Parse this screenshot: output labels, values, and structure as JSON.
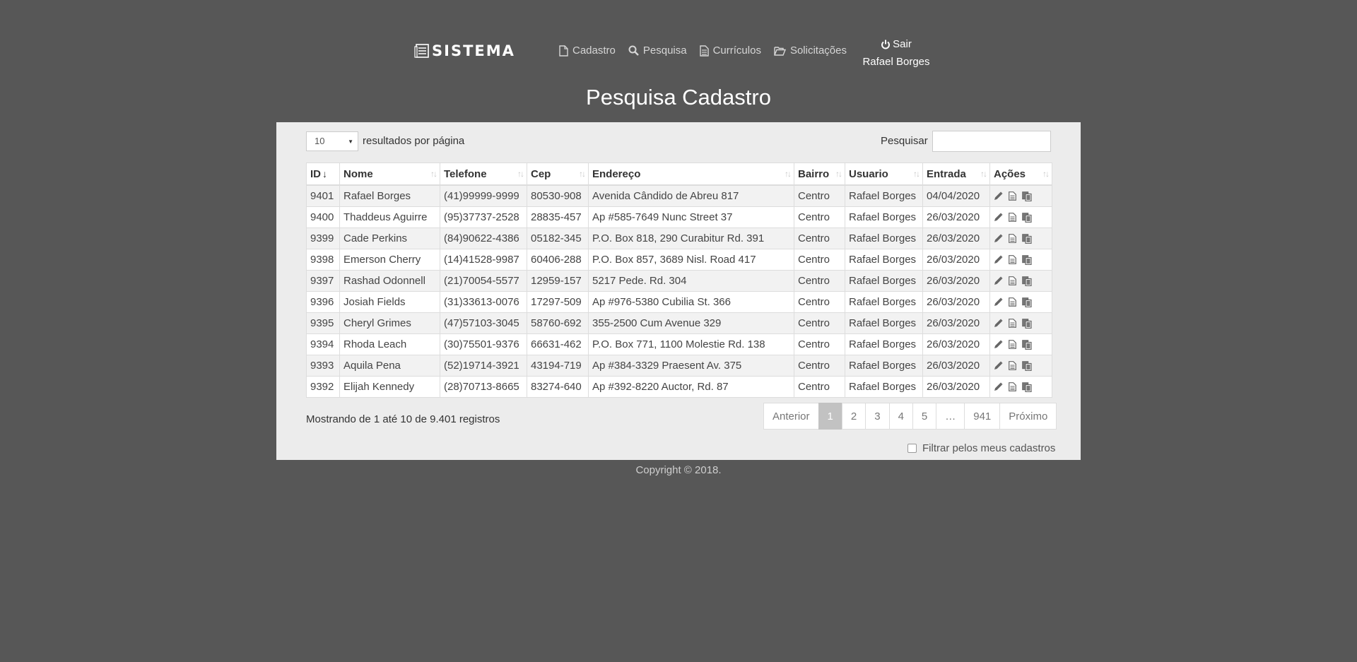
{
  "brand": {
    "name": "SISTEMA",
    "logo_icon": "list-icon"
  },
  "nav": [
    {
      "label": "Cadastro",
      "icon": "file-icon"
    },
    {
      "label": "Pesquisa",
      "icon": "search-icon"
    },
    {
      "label": "Currículos",
      "icon": "document-icon"
    },
    {
      "label": "Solicitações",
      "icon": "folder-open-icon"
    }
  ],
  "user": {
    "logout_label": "Sair",
    "logout_icon": "power-icon",
    "name": "Rafael Borges"
  },
  "page_title": "Pesquisa Cadastro",
  "controls": {
    "page_length": "10",
    "page_length_label": "resultados por página",
    "search_label": "Pesquisar",
    "search_value": ""
  },
  "table": {
    "columns": [
      "ID",
      "Nome",
      "Telefone",
      "Cep",
      "Endereço",
      "Bairro",
      "Usuario",
      "Entrada",
      "Ações"
    ],
    "sorted_column": "ID",
    "sort_direction": "descending",
    "action_icons": [
      "pencil-icon",
      "document-icon",
      "copy-icon"
    ],
    "rows": [
      [
        "9401",
        "Rafael Borges",
        "(41)99999-9999",
        "80530-908",
        "Avenida Cândido de Abreu 817",
        "Centro",
        "Rafael Borges",
        "04/04/2020"
      ],
      [
        "9400",
        "Thaddeus Aguirre",
        "(95)37737-2528",
        "28835-457",
        "Ap #585-7649 Nunc Street 37",
        "Centro",
        "Rafael Borges",
        "26/03/2020"
      ],
      [
        "9399",
        "Cade Perkins",
        "(84)90622-4386",
        "05182-345",
        "P.O. Box 818, 290 Curabitur Rd. 391",
        "Centro",
        "Rafael Borges",
        "26/03/2020"
      ],
      [
        "9398",
        "Emerson Cherry",
        "(14)41528-9987",
        "60406-288",
        "P.O. Box 857, 3689 Nisl. Road 417",
        "Centro",
        "Rafael Borges",
        "26/03/2020"
      ],
      [
        "9397",
        "Rashad Odonnell",
        "(21)70054-5577",
        "12959-157",
        "5217 Pede. Rd. 304",
        "Centro",
        "Rafael Borges",
        "26/03/2020"
      ],
      [
        "9396",
        "Josiah Fields",
        "(31)33613-0076",
        "17297-509",
        "Ap #976-5380 Cubilia St. 366",
        "Centro",
        "Rafael Borges",
        "26/03/2020"
      ],
      [
        "9395",
        "Cheryl Grimes",
        "(47)57103-3045",
        "58760-692",
        "355-2500 Cum Avenue 329",
        "Centro",
        "Rafael Borges",
        "26/03/2020"
      ],
      [
        "9394",
        "Rhoda Leach",
        "(30)75501-9376",
        "66631-462",
        "P.O. Box 771, 1100 Molestie Rd. 138",
        "Centro",
        "Rafael Borges",
        "26/03/2020"
      ],
      [
        "9393",
        "Aquila Pena",
        "(52)19714-3921",
        "43194-719",
        "Ap #384-3329 Praesent Av. 375",
        "Centro",
        "Rafael Borges",
        "26/03/2020"
      ],
      [
        "9392",
        "Elijah Kennedy",
        "(28)70713-8665",
        "83274-640",
        "Ap #392-8220 Auctor, Rd. 87",
        "Centro",
        "Rafael Borges",
        "26/03/2020"
      ]
    ]
  },
  "info_text": "Mostrando de 1 até 10 de 9.401 registros",
  "pagination": {
    "previous": "Anterior",
    "next": "Próximo",
    "pages": [
      "1",
      "2",
      "3",
      "4",
      "5",
      "…",
      "941"
    ],
    "current": "1"
  },
  "filter": {
    "label": "Filtrar pelos meus cadastros",
    "checked": false
  },
  "footer": "Copyright © 2018."
}
